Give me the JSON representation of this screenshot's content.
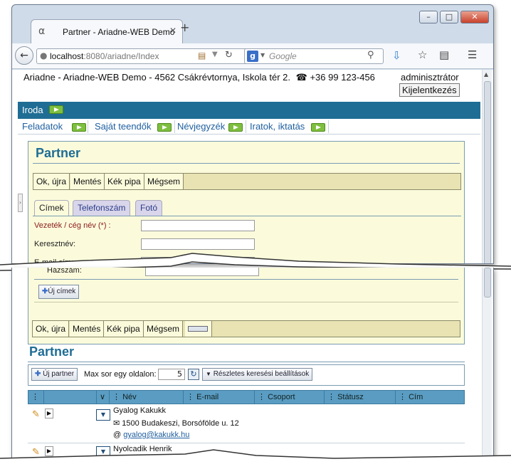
{
  "browser": {
    "tab_title": "Partner - Ariadne-WEB Demo",
    "new_tab_symbol": "+",
    "url_host": "localhost",
    "url_path": ":8080/ariadne/Index",
    "search_engine": "Google",
    "search_placeholder": "Google",
    "icons": [
      "back-arrow-icon",
      "globe-icon",
      "bookmark-star-icon",
      "download-icon",
      "menu-icon",
      "reload-icon",
      "search-icon"
    ]
  },
  "header": {
    "app_line": "Ariadne -  Ariadne-WEB Demo - 4562 Csákrévtornya, Iskola tér 2.",
    "phone": "+36 99 123-456",
    "user": "adminisztrátor",
    "logout_label": "Kijelentkezés"
  },
  "topnav": {
    "section": "Iroda",
    "items": [
      {
        "label": "Feladatok"
      },
      {
        "label": "Saját teendők"
      },
      {
        "label": "Névjegyzék"
      },
      {
        "label": "Iratok, iktatás"
      }
    ]
  },
  "form": {
    "title": "Partner",
    "toolbar": [
      "Ok, újra",
      "Mentés",
      "Kék pipa",
      "Mégsem"
    ],
    "tabs": [
      {
        "label": "Címek",
        "active": true
      },
      {
        "label": "Telefonszám",
        "active": false
      },
      {
        "label": "Fotó",
        "active": false
      }
    ],
    "fields": [
      {
        "label": "Vezeték / cég név (*) :",
        "required": true,
        "value": ""
      },
      {
        "label": "Keresztnév:",
        "required": false,
        "value": ""
      },
      {
        "label": "E-mail cím:",
        "required": false,
        "value": ""
      }
    ],
    "lower_field": {
      "label": "Házszám:",
      "value": ""
    },
    "new_address_button": "Új címek",
    "bottom_toolbar": [
      "Ok, újra",
      "Mentés",
      "Kék pipa",
      "Mégsem"
    ]
  },
  "list": {
    "title": "Partner",
    "new_partner_button": "Új partner",
    "max_rows_label": "Max sor egy oldalon:",
    "max_rows_value": "5",
    "advanced_search_button": "Részletes keresési beállítások",
    "columns": [
      "Név",
      "E-mail",
      "Csoport",
      "Státusz",
      "Cím"
    ],
    "rows": [
      {
        "name": "Gyalog Kakukk",
        "address": "1500 Budakeszi, Borsófölde u. 12",
        "email": "gyalog@kakukk.hu"
      },
      {
        "name": "Nyolcadik Henrik"
      }
    ]
  },
  "colors": {
    "accent": "#1f6d94",
    "panel": "#fbfbdc",
    "toolbar": "#e9e2b2",
    "link": "#1f5fa0"
  }
}
